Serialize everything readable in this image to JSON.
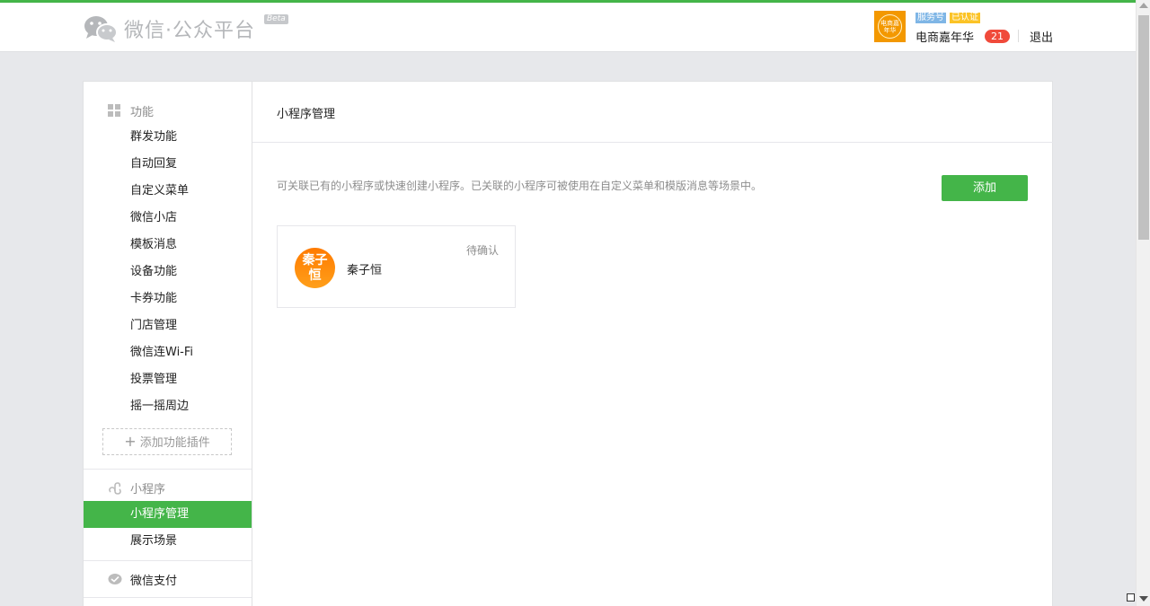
{
  "colors": {
    "accent": "#44b549",
    "badge": "#f04a3b",
    "avatar_bg": "#f39800"
  },
  "header": {
    "logo_text": "微信·公众平台",
    "beta": "Beta",
    "account": {
      "avatar_icon": "certified-seal-icon",
      "avatar_text": "电商嘉年华",
      "service_tag": "服务号",
      "verified_tag": "已认证",
      "name": "电商嘉年华",
      "message_count": "21"
    },
    "logout": "退出"
  },
  "sidebar": {
    "sections": [
      {
        "title": "功能",
        "icon": "grid-icon",
        "items": [
          "群发功能",
          "自动回复",
          "自定义菜单",
          "微信小店",
          "模板消息",
          "设备功能",
          "卡券功能",
          "门店管理",
          "微信连Wi-Fi",
          "投票管理",
          "摇一摇周边"
        ]
      },
      {
        "title": "小程序",
        "icon": "miniprogram-icon",
        "items": [
          "小程序管理",
          "展示场景"
        ],
        "active": "小程序管理"
      },
      {
        "title": "微信支付",
        "icon": "wechat-pay-icon",
        "items": []
      }
    ],
    "add_plugin": "添加功能插件"
  },
  "main": {
    "title": "小程序管理",
    "description": "可关联已有的小程序或快速创建小程序。已关联的小程序可被使用在自定义菜单和模版消息等场景中。",
    "add_button": "添加",
    "cards": [
      {
        "avatar_text": "秦子恒",
        "name": "秦子恒",
        "status": "待确认"
      }
    ]
  }
}
